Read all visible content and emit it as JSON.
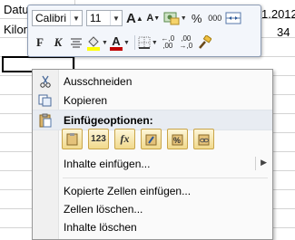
{
  "sheet": {
    "cells": [
      {
        "text": "Datu",
        "name": "cell-a1"
      },
      {
        "text": "Kilon",
        "name": "cell-a2"
      },
      {
        "text": "1.2012",
        "name": "cell-date-partial"
      },
      {
        "text": "34",
        "name": "cell-value"
      }
    ]
  },
  "toolbar": {
    "font": "Calibri",
    "size": "11",
    "grow_font": "A",
    "shrink_font": "A",
    "percent": "%",
    "thousands": "000",
    "bold": "F",
    "italic": "K",
    "increase_decimal_top": "←,0",
    "increase_decimal_bottom": ",00",
    "decrease_decimal_top": ",00",
    "decrease_decimal_bottom": "→,0",
    "currency_symbol": "€"
  },
  "menu": {
    "cut": "Ausschneiden",
    "copy": "Kopieren",
    "paste_options_header": "Einfügeoptionen:",
    "paste_special": "Inhalte einfügen...",
    "insert_copied": "Kopierte Zellen einfügen...",
    "delete_cells": "Zellen löschen...",
    "clear_contents": "Inhalte löschen",
    "paste_buttons": [
      {
        "name": "paste-values-button",
        "label": "123"
      },
      {
        "name": "paste-formulas-button",
        "label": "fx"
      }
    ]
  },
  "colors": {
    "accent_red": "#c00000",
    "highlight_yellow": "#ffff00"
  }
}
